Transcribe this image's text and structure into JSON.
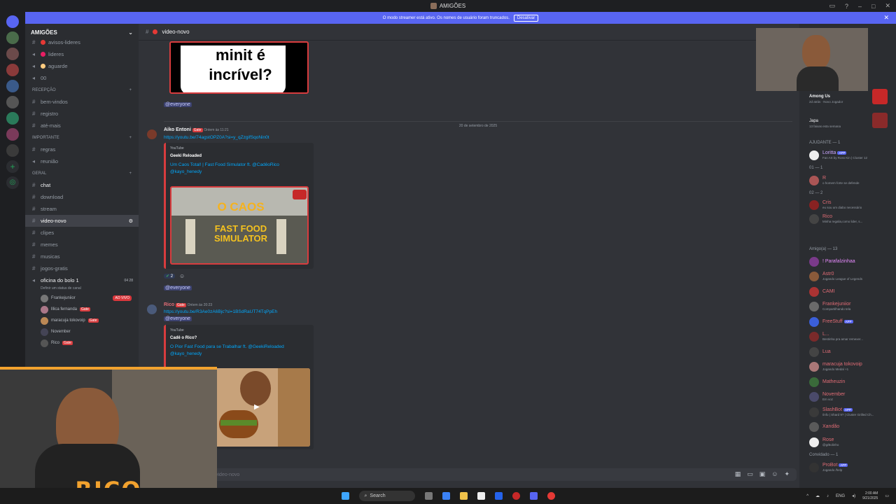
{
  "window": {
    "title": "AMIGÕES"
  },
  "banner": {
    "text": "O modo streamer está ativo. Os nomes de usuário foram truncados.",
    "button": "Desativar"
  },
  "server": {
    "name": "AMIGÕES"
  },
  "channels_top": [
    {
      "label": "avisos-lideres",
      "emoji": "#e53935"
    },
    {
      "label": "lideres",
      "emoji": "#e91e63"
    },
    {
      "label": "aguarde",
      "emoji": "#ffcc80"
    },
    {
      "label": "00",
      "emoji": ""
    }
  ],
  "categories": [
    {
      "label": "RECEPÇÃO",
      "channels": [
        "bem-vindos",
        "registro",
        "até-mais"
      ]
    },
    {
      "label": "IMPORTANTE",
      "channels": [
        "regras",
        "reunião"
      ]
    },
    {
      "label": "Geral",
      "channels": [
        "chat",
        "download",
        "stream",
        "video-novo",
        "clipes",
        "memes",
        "musicas",
        "jogos-gratis"
      ]
    }
  ],
  "voice": {
    "channel": "oficina do bolo 1",
    "status_hint": "Definir um status de canal",
    "counts": "04 28",
    "live_label": "AO VIVO",
    "users": [
      "Frankejuniior",
      "lllica fernanda",
      "maracuja tokovoip",
      "November",
      "Rico"
    ],
    "gate": "Gate"
  },
  "channel_header": {
    "name": "video-novo"
  },
  "thumb1": {
    "line1": "minit é",
    "line2": "incrível?"
  },
  "messages": {
    "mention": "@everyone",
    "date_divider": "20 de setembro de 2025",
    "m1": {
      "author": "Aiko Entoni",
      "tag": "Gate",
      "time": "Ontem às 11:21",
      "link": "https://youtu.be/74agstOPZ0A?si=y_qZzgifSqoNin0t",
      "provider": "YouTube",
      "embed_author": "Geeki Reloaded",
      "embed_title": "Um Caos Total! | Fast Food Simulator ft. @CadêoRico @kayo_henedy",
      "thumb_text1": "O CAOS",
      "thumb_text2": "FAST FOOD SIMULATOR",
      "reaction_count": "2"
    },
    "m2": {
      "author": "Rico",
      "tag": "Gate",
      "time": "Ontem às 20:23",
      "link": "https://youtu.be/R3Ae0zA6Bjc?si=1BSdRaUT74TqPpEh",
      "provider": "YouTube",
      "embed_author": "Cadê o Rico?",
      "embed_title": "O Pior Fast Food para se Trabalhar ft. @GeekiReloaded @kayo_henedy"
    }
  },
  "input": {
    "placeholder": "video-novo"
  },
  "members": {
    "activity": {
      "game": "Among Us",
      "sub": "2d atrás · Novo Jogador",
      "user": "Japa",
      "user_status": "13 faixas esta semana"
    },
    "groups": [
      {
        "label": "AJUDANTE — 1",
        "items": [
          {
            "name": "Loritta",
            "color": "#c9a6ff",
            "status": "Fan Art by Ross Kin | Cluster 12",
            "badge": "APP"
          }
        ]
      },
      {
        "label": "01 — 1",
        "items": [
          {
            "name": "R",
            "color": "#e06c75",
            "status": "o homem forte se defende",
            "badge": ""
          }
        ]
      },
      {
        "label": "02 — 2",
        "items": [
          {
            "name": "Cris",
            "color": "#e06c75",
            "status": "eu sou um diabo necessário",
            "badge": ""
          },
          {
            "name": "Rico",
            "color": "#e06c75",
            "status": "Minha regalia,como lider, s...",
            "badge": ""
          }
        ]
      },
      {
        "label": "Amigo(a) — 13",
        "items": [
          {
            "name": "! Parafalzinhaa",
            "color": "#e88bff",
            "status": "",
            "badge": ""
          },
          {
            "name": "Astr0",
            "color": "#e06c75",
            "status": "Jogando League of Legends",
            "badge": ""
          },
          {
            "name": "CAMI",
            "color": "#e06c75",
            "status": "",
            "badge": ""
          },
          {
            "name": "Frankejuniior",
            "color": "#e06c75",
            "status": "Compartilhando tela",
            "badge": ""
          },
          {
            "name": "FreeStuff",
            "color": "#e06c75",
            "status": "",
            "badge": "APP"
          },
          {
            "name": "L...",
            "color": "#e06c75",
            "status": "Bestinha pra amar remexer...",
            "badge": ""
          },
          {
            "name": "Lua",
            "color": "#e06c75",
            "status": "",
            "badge": ""
          },
          {
            "name": "maracuja tokovoip",
            "color": "#e06c75",
            "status": "Jogando Medal +1",
            "badge": ""
          },
          {
            "name": "Matheuzin",
            "color": "#e06c75",
            "status": "",
            "badge": ""
          },
          {
            "name": "November",
            "color": "#e06c75",
            "status": "Em voz",
            "badge": ""
          },
          {
            "name": "SlashBot",
            "color": "#e06c75",
            "status": "/info | Shard 9? | Cluster Grilled Ch...",
            "badge": "APP"
          },
          {
            "name": "Xandão",
            "color": "#e06c75",
            "status": "",
            "badge": ""
          },
          {
            "name": "Rose",
            "color": "#e06c75",
            "status": "@g/Bolinho",
            "badge": ""
          }
        ]
      },
      {
        "label": "Convidado — 1",
        "items": [
          {
            "name": "ProBot",
            "color": "#e06c75",
            "status": "Jogando /help",
            "badge": "APP"
          }
        ]
      }
    ]
  },
  "overlay": {
    "streamer": "RICO"
  },
  "taskbar": {
    "search": "Search",
    "lang": "ENG",
    "time": "2:00 AM",
    "date": "9/21/2025"
  }
}
